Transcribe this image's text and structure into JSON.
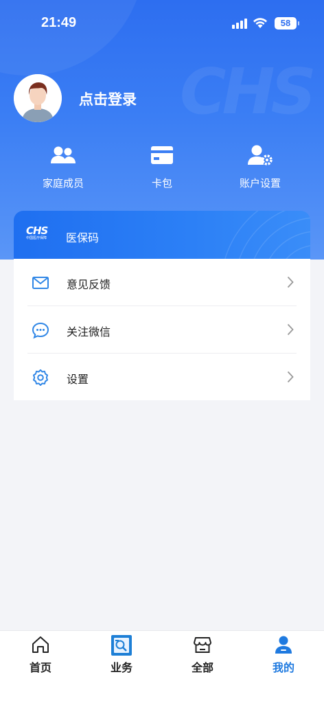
{
  "status_bar": {
    "time": "21:49",
    "battery": "58"
  },
  "profile": {
    "login_text": "点击登录"
  },
  "quick_actions": [
    {
      "label": "家庭成员",
      "icon": "family-members-icon"
    },
    {
      "label": "卡包",
      "icon": "card-wallet-icon"
    },
    {
      "label": "账户设置",
      "icon": "account-settings-icon"
    }
  ],
  "medical_code": {
    "logo_text": "CHS",
    "logo_subtext": "中国医疗保障",
    "label": "医保码"
  },
  "menu": [
    {
      "label": "意见反馈",
      "icon": "envelope-icon"
    },
    {
      "label": "关注微信",
      "icon": "chat-bubble-icon"
    },
    {
      "label": "设置",
      "icon": "gear-icon"
    }
  ],
  "tabs": [
    {
      "label": "首页",
      "icon": "home-icon",
      "active": false
    },
    {
      "label": "业务",
      "icon": "business-icon",
      "active": false
    },
    {
      "label": "全部",
      "icon": "store-icon",
      "active": false
    },
    {
      "label": "我的",
      "icon": "user-icon",
      "active": true
    }
  ],
  "colors": {
    "primary": "#2d6ef0",
    "active_tab": "#1f7ae0",
    "icon_blue": "#2f86e6",
    "background": "#f3f4f8"
  }
}
